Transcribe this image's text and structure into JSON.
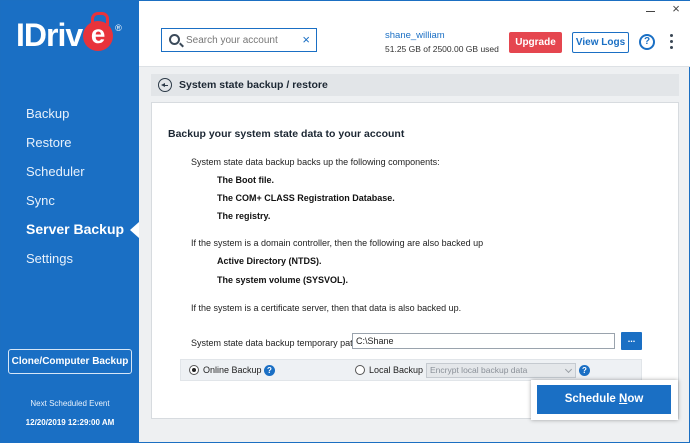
{
  "brand": {
    "logo_text": "IDriv",
    "logo_e": "e",
    "logo_reg": "®"
  },
  "sidebar": {
    "items": [
      {
        "label": "Backup",
        "active": false
      },
      {
        "label": "Restore",
        "active": false
      },
      {
        "label": "Scheduler",
        "active": false
      },
      {
        "label": "Sync",
        "active": false
      },
      {
        "label": "Server Backup",
        "active": true
      },
      {
        "label": "Settings",
        "active": false
      }
    ],
    "clone_button": "Clone/Computer Backup",
    "next_event_label": "Next Scheduled Event",
    "next_event_date": "12/20/2019 12:29:00 AM"
  },
  "header": {
    "search_placeholder": "Search your account",
    "clear": "×",
    "username": "shane_william",
    "usage": "51.25 GB of 2500.00 GB used",
    "upgrade": "Upgrade",
    "view_logs": "View Logs",
    "help": "?",
    "close": "×"
  },
  "breadcrumb": {
    "title": "System state backup / restore"
  },
  "content": {
    "heading": "Backup your system state data to your account",
    "intro": "System state data backup backs up the following components:",
    "components": [
      "The Boot file.",
      "The COM+ CLASS Registration Database.",
      "The registry."
    ],
    "dc_text": "If the system is a domain controller, then the following are also backed up",
    "dc_items": [
      "Active Directory (NTDS).",
      "The system volume (SYSVOL)."
    ],
    "cert_text": "If the system is a certificate server, then that data is also backed up.",
    "path_label": "System state data backup temporary path",
    "path_value": "C:\\Shane",
    "browse": "...",
    "online_label": "Online Backup",
    "local_label": "Local Backup",
    "encrypt_placeholder": "Encrypt local backup data",
    "info": "?"
  },
  "schedule": {
    "label_pre": "Schedule ",
    "label_u": "N",
    "label_post": "ow"
  },
  "colors": {
    "sidebar": "#1a6fc4",
    "upgrade": "#e5464f",
    "accent": "#1a6fc4"
  }
}
